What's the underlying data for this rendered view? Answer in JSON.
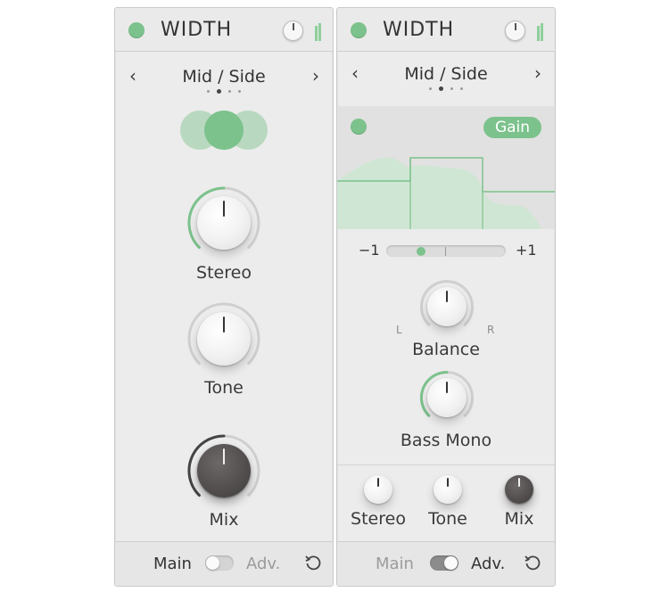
{
  "left_panel": {
    "title": "WIDTH",
    "mode": "Mid / Side",
    "page_indicator": {
      "total": 4,
      "active": 2
    },
    "knobs": [
      {
        "label": "Stereo",
        "value": 0.5
      },
      {
        "label": "Tone",
        "value": 0.5
      },
      {
        "label": "Mix",
        "value": 0.5
      }
    ],
    "footer": {
      "left_label": "Main",
      "right_label": "Adv.",
      "active": "Main"
    }
  },
  "right_panel": {
    "title": "WIDTH",
    "mode": "Mid / Side",
    "page_indicator": {
      "total": 4,
      "active": 2
    },
    "graph_button": "Gain",
    "slider": {
      "min_label": "−1",
      "max_label": "+1",
      "value": -0.45
    },
    "knobs": [
      {
        "label": "Balance",
        "left_label": "L",
        "right_label": "R",
        "value": 0.5
      },
      {
        "label": "Bass Mono",
        "value": 0.5
      }
    ],
    "mini_knobs": [
      {
        "label": "Stereo"
      },
      {
        "label": "Tone"
      },
      {
        "label": "Mix"
      }
    ],
    "footer": {
      "left_label": "Main",
      "right_label": "Adv.",
      "active": "Adv."
    }
  },
  "colors": {
    "accent": "#7cc28c",
    "panel": "#ececec",
    "dark_knob": "#514d4d"
  }
}
